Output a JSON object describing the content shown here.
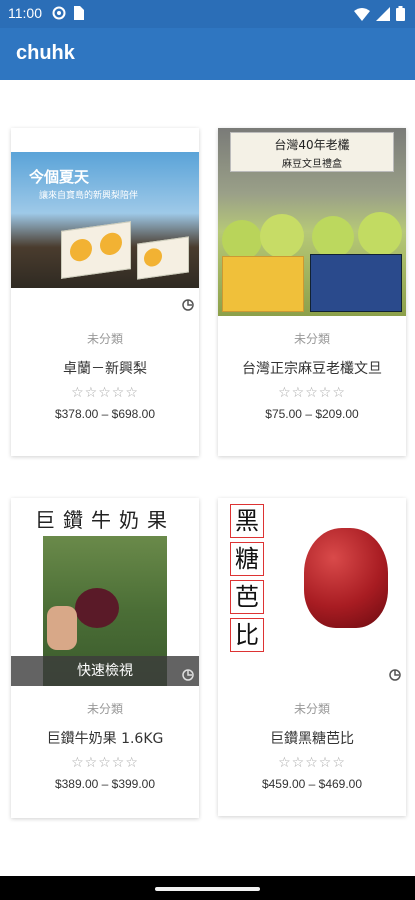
{
  "status": {
    "time": "11:00"
  },
  "app": {
    "title": "chuhk"
  },
  "products": [
    {
      "category": "未分類",
      "name": "卓蘭－新興梨",
      "rating": "☆☆☆☆☆",
      "price": "$378.00 – $698.00",
      "banner_title": "今個夏天",
      "banner_sub": "讓來自寶島的新興梨陪伴"
    },
    {
      "category": "未分類",
      "name": "台灣正宗麻豆老欉文旦",
      "rating": "☆☆☆☆☆",
      "price": "$75.00 – $209.00",
      "banner_title": "台灣40年老欉",
      "banner_sub": "麻豆文旦禮盒"
    },
    {
      "category": "未分類",
      "name": "巨鑽牛奶果 1.6KG",
      "rating": "☆☆☆☆☆",
      "price": "$389.00 – $399.00",
      "banner_title": "巨鑽牛奶果",
      "quick_view": "快速檢視"
    },
    {
      "category": "未分類",
      "name": "巨鑽黑糖芭比",
      "rating": "☆☆☆☆☆",
      "price": "$459.00 – $469.00",
      "vertical_title": [
        "黑",
        "糖",
        "芭",
        "比"
      ]
    }
  ]
}
